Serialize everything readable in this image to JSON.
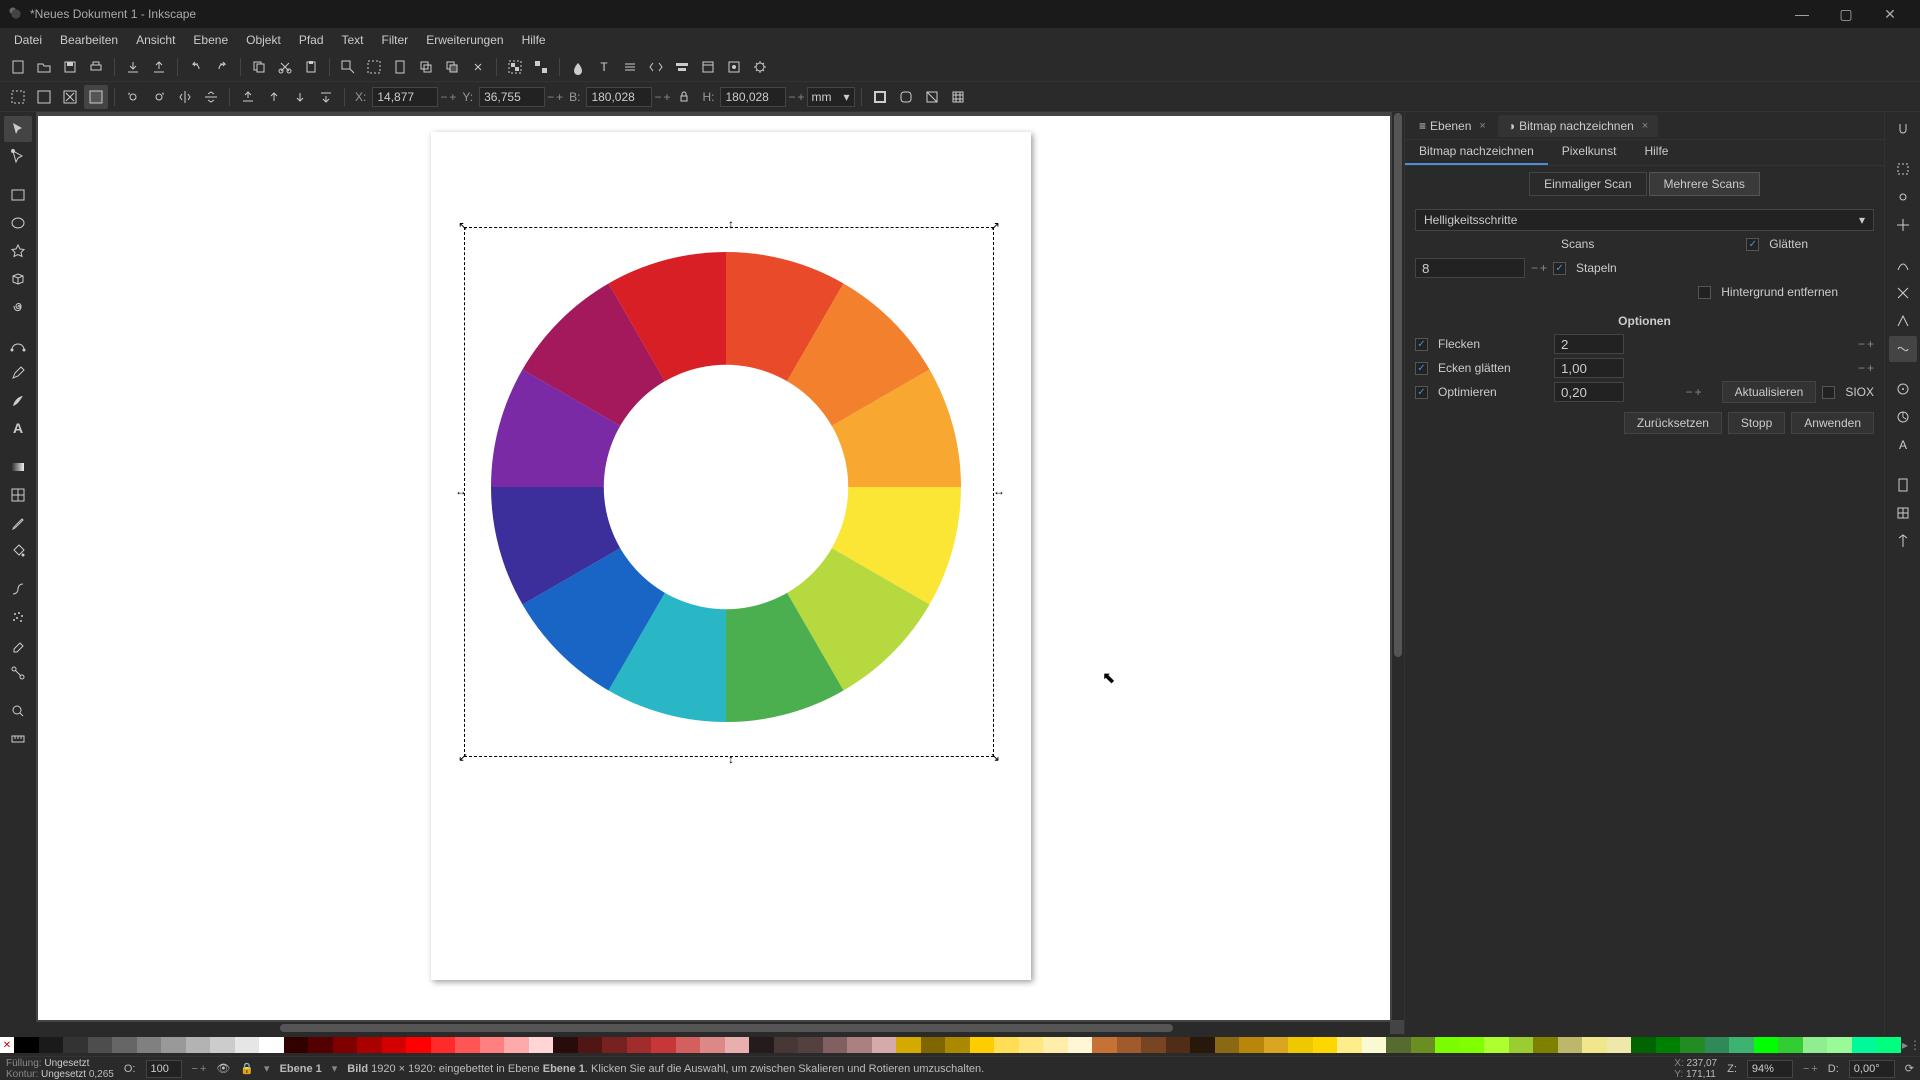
{
  "title": "*Neues Dokument 1 - Inkscape",
  "menu": [
    "Datei",
    "Bearbeiten",
    "Ansicht",
    "Ebene",
    "Objekt",
    "Pfad",
    "Text",
    "Filter",
    "Erweiterungen",
    "Hilfe"
  ],
  "toolbar2": {
    "x_label": "X:",
    "x_val": "14,877",
    "y_label": "Y:",
    "y_val": "36,755",
    "w_label": "B:",
    "w_val": "180,028",
    "h_label": "H:",
    "h_val": "180,028",
    "unit": "mm"
  },
  "dock": {
    "tabs": {
      "layers": "Ebenen",
      "trace": "Bitmap nachzeichnen"
    },
    "inner_tabs": {
      "trace": "Bitmap nachzeichnen",
      "pixel": "Pixelkunst",
      "help": "Hilfe"
    },
    "scan_tabs": {
      "single": "Einmaliger Scan",
      "multi": "Mehrere Scans"
    },
    "method": "Helligkeitsschritte",
    "scans_label": "Scans",
    "scans_val": "8",
    "smooth": "Glätten",
    "stack": "Stapeln",
    "removebg": "Hintergrund entfernen",
    "options_title": "Optionen",
    "speckles": "Flecken",
    "speckles_val": "2",
    "corners": "Ecken glätten",
    "corners_val": "1,00",
    "optimize": "Optimieren",
    "optimize_val": "0,20",
    "update": "Aktualisieren",
    "siox": "SIOX",
    "reset": "Zurücksetzen",
    "stop": "Stopp",
    "apply": "Anwenden"
  },
  "status": {
    "fill_label": "Füllung:",
    "fill_val": "Ungesetzt",
    "stroke_label": "Kontur:",
    "stroke_val": "Ungesetzt",
    "stroke_w": "0,265",
    "opacity_label": "O:",
    "opacity_val": "100",
    "layer": "Ebene 1",
    "hint_obj": "Bild",
    "hint_dims": "1920 × 1920:",
    "hint_pre": "eingebettet in Ebene",
    "hint_layer": "Ebene 1",
    "hint_rest": ". Klicken Sie auf die Auswahl, um zwischen Skalieren und Rotieren umzuschalten.",
    "coord_x_label": "X:",
    "coord_x": "237,07",
    "coord_y_label": "Y:",
    "coord_y": "171,11",
    "zoom_label": "Z:",
    "zoom": "94%",
    "rot_label": "D:",
    "rot": "0,00°"
  },
  "palette_colors": [
    "#000000",
    "#1a1a1a",
    "#333333",
    "#4d4d4d",
    "#666666",
    "#808080",
    "#999999",
    "#b3b3b3",
    "#cccccc",
    "#e6e6e6",
    "#ffffff",
    "#330000",
    "#550000",
    "#800000",
    "#aa0000",
    "#d40000",
    "#ff0000",
    "#ff2a2a",
    "#ff5555",
    "#ff8080",
    "#ffaaaa",
    "#ffd5d5",
    "#280b0b",
    "#501616",
    "#782121",
    "#a02c2c",
    "#c83737",
    "#d35f5f",
    "#de8787",
    "#e9afaf",
    "#241c1c",
    "#483737",
    "#554040",
    "#806060",
    "#aa8080",
    "#d4aaaa",
    "#d4aa00",
    "#806600",
    "#aa8800",
    "#ffcc00",
    "#ffdd55",
    "#ffe680",
    "#ffeeaa",
    "#fff6d5",
    "#c87137",
    "#a05a2c",
    "#784421",
    "#502d16",
    "#28170b",
    "#8b6914",
    "#b8860b",
    "#daa520",
    "#eec900",
    "#ffd700",
    "#ffec8b",
    "#fafad2",
    "#556b2f",
    "#6b8e23",
    "#7cfc00",
    "#7fff00",
    "#adff2f",
    "#9acd32",
    "#808000",
    "#bdb76b",
    "#f0e68c",
    "#eee8aa",
    "#006400",
    "#008000",
    "#228b22",
    "#2e8b57",
    "#3cb371",
    "#00ff00",
    "#32cd32",
    "#90ee90",
    "#98fb98",
    "#00fa9a",
    "#00ff7f"
  ]
}
